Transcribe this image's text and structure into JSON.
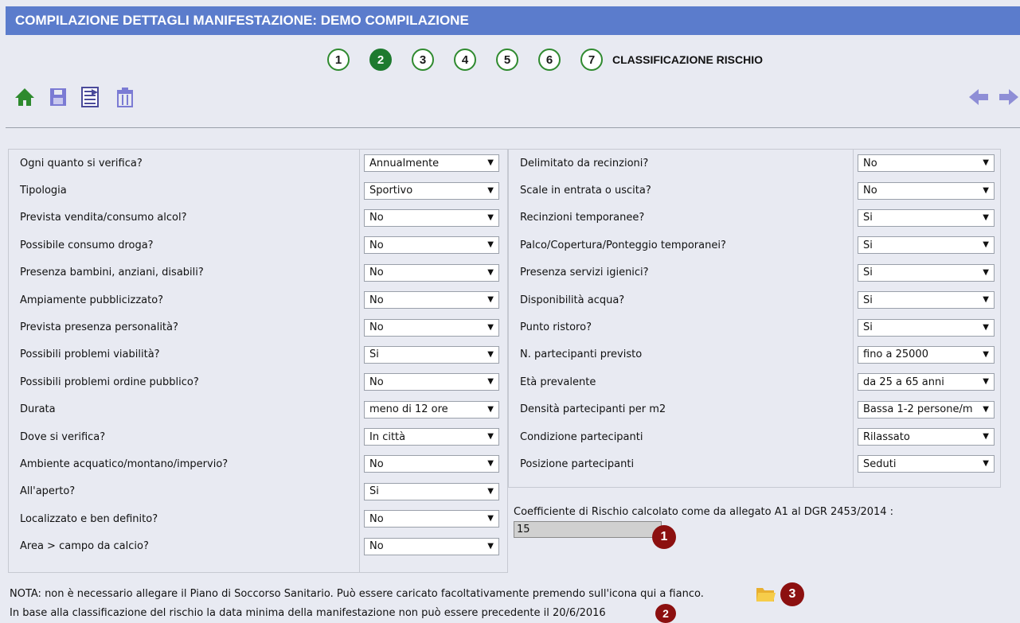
{
  "header": {
    "title": "COMPILAZIONE DETTAGLI MANIFESTAZIONE: DEMO COMPILAZIONE"
  },
  "steps": {
    "items": [
      "1",
      "2",
      "3",
      "4",
      "5",
      "6",
      "7"
    ],
    "active": "2",
    "label": "CLASSIFICAZIONE RISCHIO"
  },
  "toolbar": {
    "icons": [
      "home-icon",
      "save-icon",
      "export-icon",
      "delete-icon"
    ]
  },
  "nav": {
    "icons": [
      "arrow-left-icon",
      "arrow-right-icon"
    ]
  },
  "left": {
    "rows": [
      {
        "label": "Ogni quanto si verifica?",
        "value": "Annualmente"
      },
      {
        "label": "Tipologia",
        "value": "Sportivo"
      },
      {
        "label": "Prevista vendita/consumo alcol?",
        "value": "No"
      },
      {
        "label": "Possibile consumo droga?",
        "value": "No"
      },
      {
        "label": "Presenza bambini, anziani, disabili?",
        "value": "No"
      },
      {
        "label": "Ampiamente pubblicizzato?",
        "value": "No"
      },
      {
        "label": "Prevista presenza personalità?",
        "value": "No"
      },
      {
        "label": "Possibili problemi viabilità?",
        "value": "Si"
      },
      {
        "label": "Possibili problemi ordine pubblico?",
        "value": "No"
      },
      {
        "label": "Durata",
        "value": "meno di 12 ore"
      },
      {
        "label": "Dove si verifica?",
        "value": "In città"
      },
      {
        "label": "Ambiente acquatico/montano/impervio?",
        "value": "No"
      },
      {
        "label": "All'aperto?",
        "value": "Si"
      },
      {
        "label": "Localizzato e ben definito?",
        "value": "No"
      },
      {
        "label": "Area > campo da calcio?",
        "value": "No"
      }
    ]
  },
  "right": {
    "rows": [
      {
        "label": "Delimitato da recinzioni?",
        "value": "No"
      },
      {
        "label": "Scale in entrata o uscita?",
        "value": "No"
      },
      {
        "label": "Recinzioni temporanee?",
        "value": "Si"
      },
      {
        "label": "Palco/Copertura/Ponteggio temporanei?",
        "value": "Si"
      },
      {
        "label": "Presenza servizi igienici?",
        "value": "Si"
      },
      {
        "label": "Disponibilità acqua?",
        "value": "Si"
      },
      {
        "label": "Punto ristoro?",
        "value": "Si"
      },
      {
        "label": "N. partecipanti previsto",
        "value": "fino a 25000"
      },
      {
        "label": "Età prevalente",
        "value": "da 25 a 65 anni"
      },
      {
        "label": "Densità partecipanti per m2",
        "value": "Bassa 1-2 persone/m"
      },
      {
        "label": "Condizione partecipanti",
        "value": "Rilassato"
      },
      {
        "label": "Posizione partecipanti",
        "value": "Seduti"
      }
    ]
  },
  "coefficient": {
    "label": "Coefficiente di Rischio calcolato come da allegato A1 al DGR 2453/2014 :",
    "value": "15"
  },
  "badges": {
    "b1": "1",
    "b2": "2",
    "b3": "3"
  },
  "notes": {
    "note1": "NOTA: non è necessario allegare il Piano di Soccorso Sanitario. Può essere caricato facoltativamente premendo sull'icona qui a fianco.",
    "note2": "In base alla classificazione del rischio la data minima della manifestazione non può essere precedente il 20/6/2016"
  },
  "colors": {
    "header": "#5b7ccc",
    "step_active": "#1e7a2f",
    "badge": "#8c1010"
  }
}
